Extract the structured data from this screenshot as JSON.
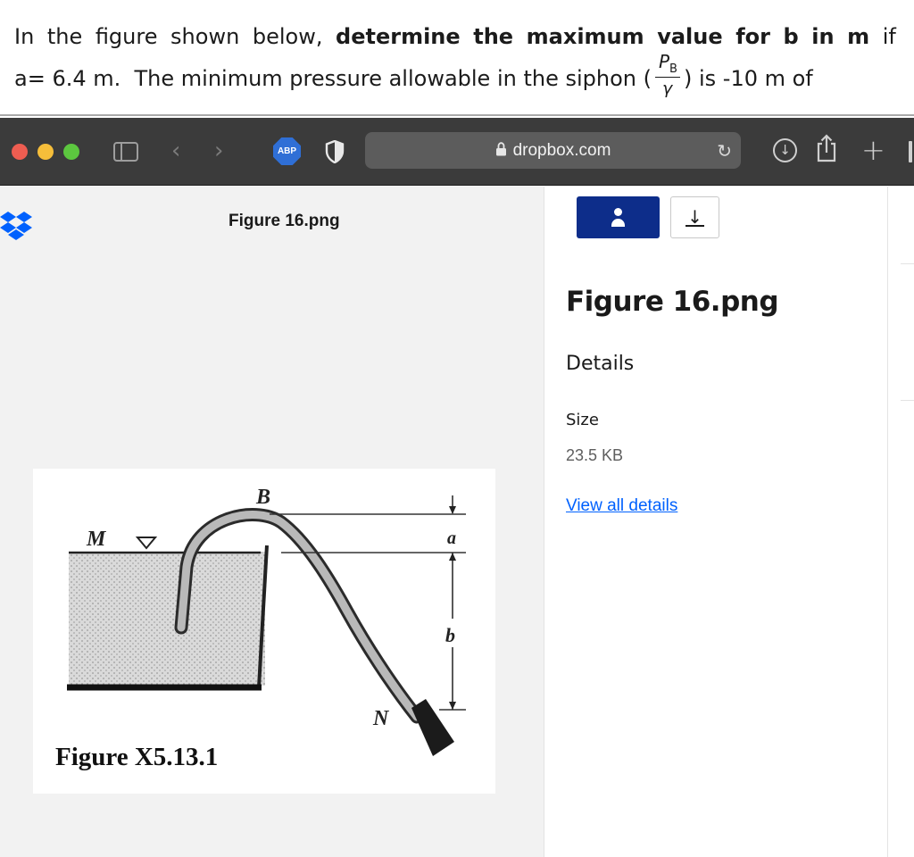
{
  "question": {
    "line1": [
      "In",
      "the",
      "figure",
      "shown",
      "below,",
      "determine",
      "the",
      "maximum",
      "value",
      "for",
      "b",
      "in",
      "m",
      "if"
    ],
    "line1_bold_from": 5,
    "line1_bold_to": 12,
    "line2_start": "a= 6.4 m.  The minimum pressure allowable in the siphon (",
    "fraction_numerator": "P",
    "fraction_sub": "B",
    "fraction_denominator": "γ",
    "line2_end": ") is -10 m of"
  },
  "browser": {
    "abp_label": "ABP",
    "address": "dropbox.com",
    "icons": [
      "sidebar-icon",
      "back-icon",
      "forward-icon",
      "adblock-icon",
      "shield-icon",
      "lock-icon",
      "reload-icon",
      "download-icon",
      "share-icon",
      "new-tab-icon"
    ]
  },
  "preview": {
    "file_name": "Figure 16.png"
  },
  "figure": {
    "label_B": "B",
    "label_M": "M",
    "label_a": "a",
    "label_b": "b",
    "label_N": "N",
    "caption": "Figure X5.13.1"
  },
  "panel": {
    "title": "Figure 16.png",
    "details_heading": "Details",
    "size_label": "Size",
    "size_value": "23.5 KB",
    "view_all_label": "View all details"
  },
  "colors": {
    "toolbar_bg": "#3b3b3b",
    "share_button": "#0d2d8a",
    "link": "#0061fe",
    "preview_bg": "#f2f2f2"
  }
}
